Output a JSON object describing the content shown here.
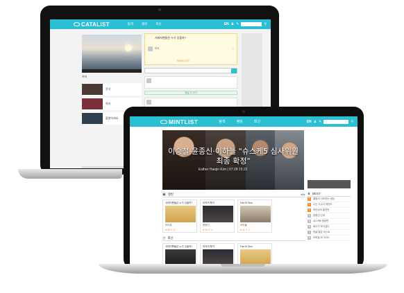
{
  "back_laptop": {
    "logo": "CATALIST",
    "nav": [
      "탐색",
      "랭킹",
      "최신"
    ],
    "lang": "EN",
    "post_question": "서태지팬들은 누가 있을까?",
    "author": "하지",
    "mint_badge": "MINTLIST",
    "list_labels": [
      "윤석",
      "하지",
      "출발하세요"
    ],
    "ghost_text": "기다리는 중",
    "blue_tag": "",
    "divider": "댓글 더 보기"
  },
  "front_laptop": {
    "logo": "MINTLIST",
    "nav": [
      "탐색",
      "랭킹",
      "최신"
    ],
    "lang": "EN",
    "hero": {
      "caption": "이승철·윤종신·이하늘 \"슈스케5 심사위원 최종 확정\"",
      "meta": "Esther Haejin Kim | 07.08 15:22"
    },
    "sections": [
      {
        "icon": "ranking-icon",
        "title": "랭킹",
        "cards": [
          {
            "title": "서태지팬들은 누가 있을까?",
            "name": "아이유",
            "stats": "♥ 88  ✎ 8"
          },
          {
            "title": "여자의 향기",
            "name": "윤종신",
            "stats": "♥ 36  ✎ 3"
          },
          {
            "title": "Fan Ki Sion",
            "name": "아이돌",
            "stats": "♥ 11  ✎ 2"
          }
        ]
      },
      {
        "icon": "recent-icon",
        "title": "최신",
        "cards": [
          {
            "title": "서태지팬들은 누가 있을까?",
            "name": "",
            "stats": ""
          },
          {
            "title": "여자의 향기",
            "name": "",
            "stats": ""
          },
          {
            "title": "Fan Ki Sion",
            "name": "",
            "stats": ""
          }
        ]
      }
    ],
    "side": {
      "title": "BEST",
      "items": [
        "앨범이 사라지는 세상",
        "나는 가수다 레전드",
        "히든싱어 출연진",
        "윤종신 신곡",
        "슈스케5 명장면",
        "바다가 보고싶다",
        "댓글 많은 리스트",
        "이하늘 DJ DOC"
      ]
    }
  }
}
